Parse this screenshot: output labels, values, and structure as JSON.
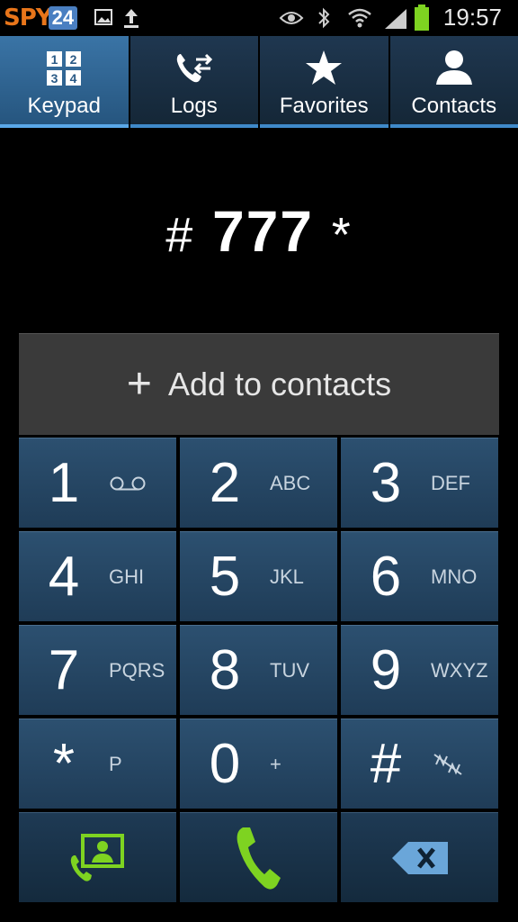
{
  "status_bar": {
    "logo_spy": "SPY",
    "logo_num": "24",
    "time": "19:57"
  },
  "tabs": [
    {
      "label": "Keypad",
      "icon": "keypad-icon",
      "active": true
    },
    {
      "label": "Logs",
      "icon": "logs-icon",
      "active": false
    },
    {
      "label": "Favorites",
      "icon": "star-icon",
      "active": false
    },
    {
      "label": "Contacts",
      "icon": "contact-icon",
      "active": false
    }
  ],
  "dialed": {
    "prefix": "#",
    "number": "777",
    "suffix": "*"
  },
  "add_contacts": {
    "plus": "+",
    "label": "Add to contacts"
  },
  "keypad": {
    "k1": {
      "digit": "1",
      "letters": ""
    },
    "k2": {
      "digit": "2",
      "letters": "ABC"
    },
    "k3": {
      "digit": "3",
      "letters": "DEF"
    },
    "k4": {
      "digit": "4",
      "letters": "GHI"
    },
    "k5": {
      "digit": "5",
      "letters": "JKL"
    },
    "k6": {
      "digit": "6",
      "letters": "MNO"
    },
    "k7": {
      "digit": "7",
      "letters": "PQRS"
    },
    "k8": {
      "digit": "8",
      "letters": "TUV"
    },
    "k9": {
      "digit": "9",
      "letters": "WXYZ"
    },
    "kstar": {
      "digit": "*",
      "letters": "P"
    },
    "k0": {
      "digit": "0",
      "letters": "+"
    },
    "khash": {
      "digit": "#",
      "letters": ""
    }
  },
  "colors": {
    "accent": "#5aa8e8",
    "call_green": "#7ed321",
    "key_bg": "#2c5070"
  }
}
